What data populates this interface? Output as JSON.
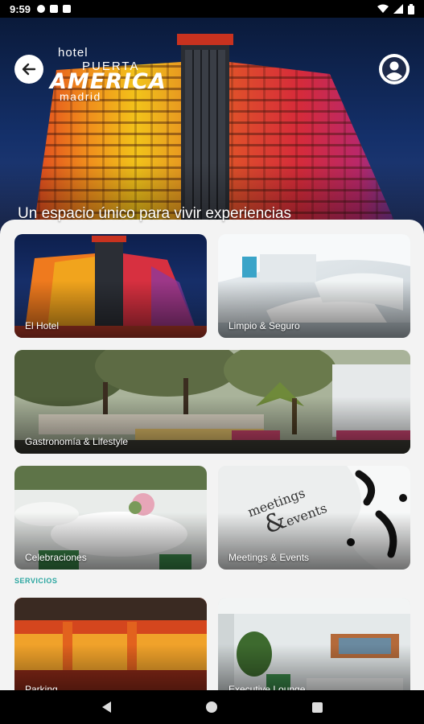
{
  "status_bar": {
    "time": "9:59",
    "left_icons": [
      "gear-icon",
      "square-icon",
      "sd-card-icon"
    ],
    "right_icons": [
      "wifi-icon",
      "signal-icon",
      "battery-icon"
    ]
  },
  "header": {
    "logo_lines": [
      "hotel",
      "PUERTA",
      "AMERICA",
      "madrid"
    ],
    "back_icon": "arrow-left-icon",
    "profile_icon": "account-circle-icon"
  },
  "hero": {
    "tagline": "Un espacio único para vivir experiencias"
  },
  "cards": [
    {
      "label": "El Hotel"
    },
    {
      "label": "Limpio & Seguro"
    },
    {
      "label": "Gastronomía & Lifestyle"
    },
    {
      "label": "Celebraciones"
    },
    {
      "label": "Meetings & Events",
      "image_text_1": "meetings",
      "image_text_2": "&",
      "image_text_3": "events"
    }
  ],
  "servicios": {
    "title": "SERVICIOS",
    "cards": [
      {
        "label": "Parking"
      },
      {
        "label": "Executive Lounge"
      }
    ]
  },
  "nav_bar": {
    "icons": [
      "back-triangle-icon",
      "home-circle-icon",
      "recents-square-icon"
    ]
  },
  "colors": {
    "accent": "#2aa6a0",
    "background": "#f3f3f3"
  }
}
